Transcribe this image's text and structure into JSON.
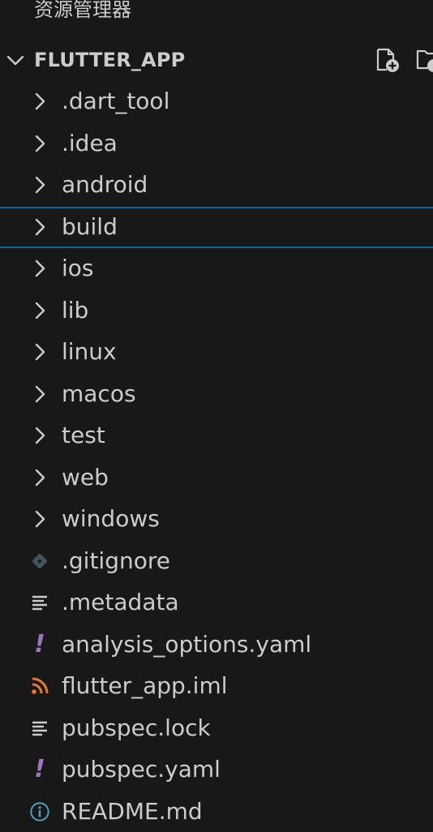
{
  "explorer": {
    "title": "资源管理器",
    "section": {
      "title": "FLUTTER_APP",
      "actions": [
        {
          "icon": "new-file-icon"
        },
        {
          "icon": "new-folder-icon"
        }
      ]
    },
    "items": [
      {
        "label": ".dart_tool",
        "kind": "folder",
        "icon": "chevron-right-icon"
      },
      {
        "label": ".idea",
        "kind": "folder",
        "icon": "chevron-right-icon"
      },
      {
        "label": "android",
        "kind": "folder",
        "icon": "chevron-right-icon"
      },
      {
        "label": "build",
        "kind": "folder",
        "icon": "chevron-right-icon",
        "selected": true
      },
      {
        "label": "ios",
        "kind": "folder",
        "icon": "chevron-right-icon"
      },
      {
        "label": "lib",
        "kind": "folder",
        "icon": "chevron-right-icon"
      },
      {
        "label": "linux",
        "kind": "folder",
        "icon": "chevron-right-icon"
      },
      {
        "label": "macos",
        "kind": "folder",
        "icon": "chevron-right-icon"
      },
      {
        "label": "test",
        "kind": "folder",
        "icon": "chevron-right-icon"
      },
      {
        "label": "web",
        "kind": "folder",
        "icon": "chevron-right-icon"
      },
      {
        "label": "windows",
        "kind": "folder",
        "icon": "chevron-right-icon"
      },
      {
        "label": ".gitignore",
        "kind": "file",
        "icon": "git-icon"
      },
      {
        "label": ".metadata",
        "kind": "file",
        "icon": "lines-icon"
      },
      {
        "label": "analysis_options.yaml",
        "kind": "file",
        "icon": "yaml-icon"
      },
      {
        "label": "flutter_app.iml",
        "kind": "file",
        "icon": "rss-icon"
      },
      {
        "label": "pubspec.lock",
        "kind": "file",
        "icon": "lines-icon"
      },
      {
        "label": "pubspec.yaml",
        "kind": "file",
        "icon": "yaml-icon"
      },
      {
        "label": "README.md",
        "kind": "file",
        "icon": "info-icon"
      }
    ],
    "colors": {
      "background": "#181818",
      "text": "#cccccc",
      "selection_border": "#0e639c",
      "git": "#41535b",
      "yaml": "#a074c4",
      "rss": "#e37933",
      "info": "#519aba"
    }
  }
}
